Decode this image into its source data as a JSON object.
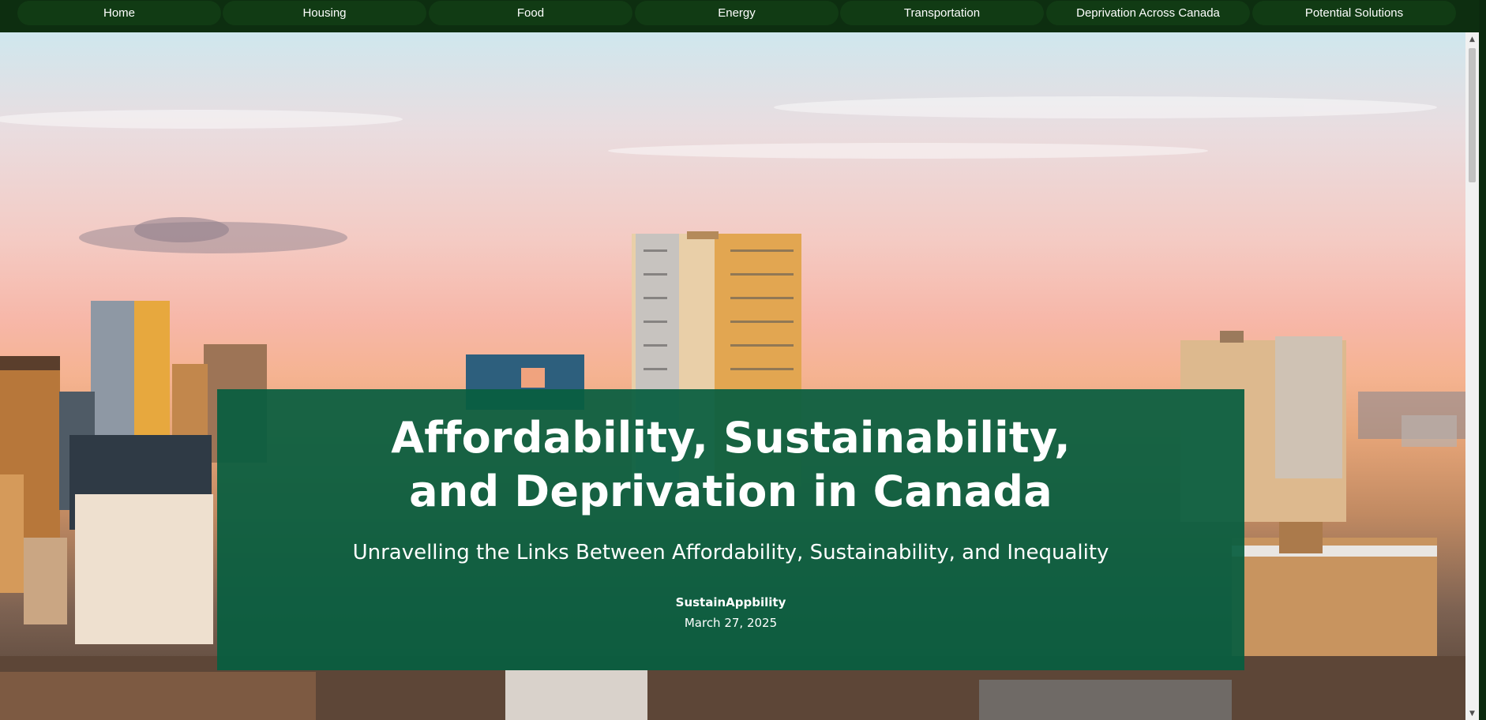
{
  "nav": {
    "items": [
      {
        "label": "Home"
      },
      {
        "label": "Housing"
      },
      {
        "label": "Food"
      },
      {
        "label": "Energy"
      },
      {
        "label": "Transportation"
      },
      {
        "label": "Deprivation Across Canada"
      },
      {
        "label": "Potential Solutions"
      }
    ]
  },
  "hero": {
    "title_line1": "Affordability, Sustainability,",
    "title_line2": "and Deprivation in Canada",
    "subtitle": "Unravelling the Links Between Affordability, Sustainability, and Inequality",
    "author": "SustainAppbility",
    "date": "March 27, 2025"
  },
  "colors": {
    "nav_background": "#0d2e10",
    "nav_item": "#113b14",
    "card_background": "#085e40",
    "text": "#ffffff"
  },
  "icons": {
    "scroll_up": "scroll-up-arrow-icon",
    "scroll_down": "scroll-down-arrow-icon"
  }
}
